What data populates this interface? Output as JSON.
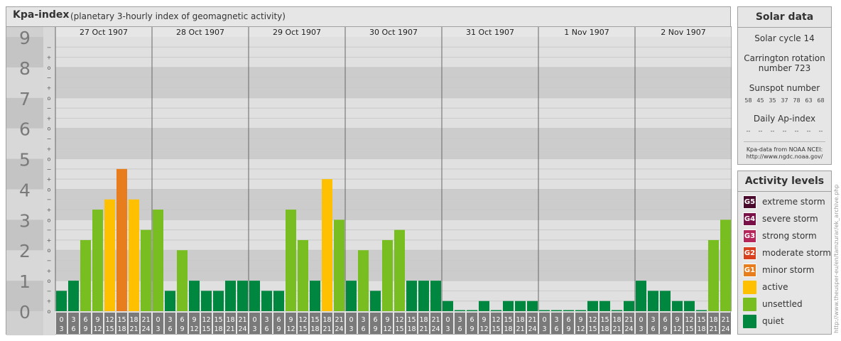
{
  "header": {
    "title": "Kpa-index",
    "subtitle": "(planetary 3-hourly index of geomagnetic activity)"
  },
  "chart_data": {
    "type": "bar",
    "ylim": [
      0,
      9
    ],
    "y_ticks": [
      "0",
      "1",
      "2",
      "3",
      "4",
      "5",
      "6",
      "7",
      "8",
      "9"
    ],
    "y_subticks": [
      "o",
      "+",
      "−"
    ],
    "days": [
      "27 Oct 1907",
      "28 Oct 1907",
      "29 Oct 1907",
      "30 Oct 1907",
      "31 Oct 1907",
      "1 Nov 1907",
      "2 Nov 1907"
    ],
    "interval_labels": [
      [
        "0",
        "3"
      ],
      [
        "3",
        "6"
      ],
      [
        "6",
        "9"
      ],
      [
        "9",
        "12"
      ],
      [
        "12",
        "15"
      ],
      [
        "15",
        "18"
      ],
      [
        "18",
        "21"
      ],
      [
        "21",
        "24"
      ]
    ],
    "values": [
      0.667,
      1.0,
      2.333,
      3.333,
      3.667,
      4.667,
      3.667,
      2.667,
      3.333,
      0.667,
      2.0,
      1.0,
      0.667,
      0.667,
      1.0,
      1.0,
      1.0,
      0.667,
      0.667,
      3.333,
      2.333,
      1.0,
      4.333,
      3.0,
      1.0,
      2.0,
      0.667,
      2.333,
      2.667,
      1.0,
      1.0,
      1.0,
      0.333,
      0.0,
      0.0,
      0.333,
      0.0,
      0.333,
      0.333,
      0.333,
      0.0,
      0.0,
      0.0,
      0.0,
      0.333,
      0.333,
      0.0,
      0.333,
      1.0,
      0.667,
      0.667,
      0.333,
      0.333,
      0.0,
      2.333,
      3.0
    ],
    "level_colors": {
      "quiet": "#00873f",
      "unsettled": "#78be20",
      "active": "#ffc000",
      "G1": "#e87d1e",
      "G2": "#d9411e",
      "G3": "#b5265b",
      "G4": "#7a1048",
      "G5": "#4a0a2e"
    },
    "band_colors": [
      "#cccccc",
      "#e0e0e0"
    ],
    "grid": true
  },
  "solar_data": {
    "title": "Solar data",
    "solar_cycle": "Solar cycle 14",
    "carrington_line1": "Carrington rotation",
    "carrington_line2": "number 723",
    "sunspot_title": "Sunspot number",
    "sunspot_values": [
      "58",
      "45",
      "35",
      "37",
      "78",
      "63",
      "68"
    ],
    "ap_title": "Daily Ap-index",
    "ap_values": [
      "--",
      "--",
      "--",
      "--",
      "--",
      "--",
      "--"
    ],
    "source_line1": "Kpa-data from NOAA NCEI:",
    "source_line2": "http://www.ngdc.noaa.gov/"
  },
  "activity_levels": {
    "title": "Activity levels",
    "items": [
      {
        "badge": "G5",
        "label": "extreme storm",
        "color": "#4a0a2e"
      },
      {
        "badge": "G4",
        "label": "severe storm",
        "color": "#7a1048"
      },
      {
        "badge": "G3",
        "label": "strong storm",
        "color": "#b5265b"
      },
      {
        "badge": "G2",
        "label": "moderate storm",
        "color": "#d9411e"
      },
      {
        "badge": "G1",
        "label": "minor storm",
        "color": "#e87d1e"
      },
      {
        "badge": "",
        "label": "active",
        "color": "#ffc000"
      },
      {
        "badge": "",
        "label": "unsettled",
        "color": "#78be20"
      },
      {
        "badge": "",
        "label": "quiet",
        "color": "#00873f"
      }
    ]
  },
  "watermark": "http://www.theusper-eu/en/tamzurar/ek_archive.php"
}
